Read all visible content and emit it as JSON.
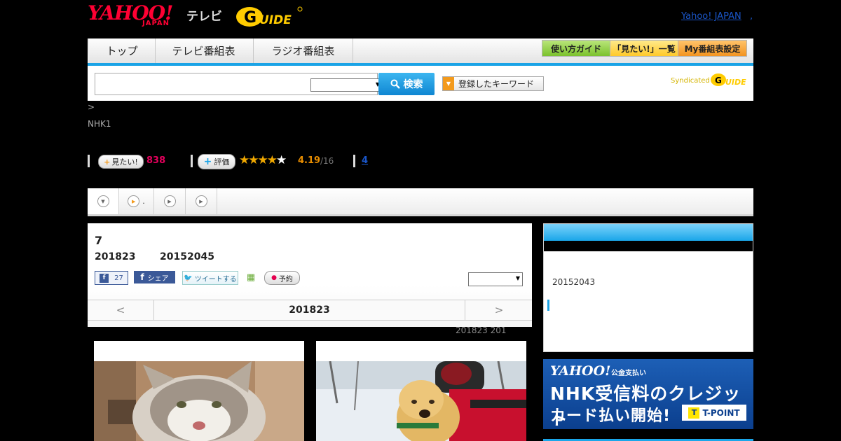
{
  "header": {
    "yahoo_logo": "YAHOO!",
    "yahoo_sub": "JAPAN",
    "tv_label": "テレビ",
    "gguide_label": "G GUIDE",
    "top_link": "Yahoo! JAPAN",
    "top_dot": ","
  },
  "nav": {
    "tabs": [
      "トップ",
      "テレビ番組表",
      "ラジオ番組表"
    ],
    "buttons": [
      {
        "label": "使い方ガイド",
        "color": "#8ccf3c"
      },
      {
        "label": "「見たい!」一覧",
        "color": "#ffd23c"
      },
      {
        "label": "My番組表設定",
        "color": "#f7a330"
      }
    ]
  },
  "search": {
    "placeholder": "",
    "button_label": "検索",
    "keyword_button": "登録したキーワード",
    "syndicated_label": "Syndicated"
  },
  "program_info": {
    "breadcrumb": ">",
    "channel": "NHK1",
    "mitai_label": "見たい!",
    "mitai_count": "838",
    "rate_label": "評価",
    "stars_filled": 4,
    "stars_total": 5,
    "rating_value": "4.19",
    "rating_count": "/16",
    "review_link": "4"
  },
  "tabs_row": [
    {
      "icon": "chevron-down-icon",
      "label": ""
    },
    {
      "icon": "play-icon",
      "label": "."
    },
    {
      "icon": "play-icon",
      "label": ""
    },
    {
      "icon": "play-icon",
      "label": ""
    }
  ],
  "program": {
    "title": "7",
    "date": "201823",
    "time": "20152045",
    "share_count": "27",
    "share_label": "シェア",
    "tweet_label": "ツイートする",
    "reserve_label": "予約",
    "pager_prev": "<",
    "pager_current": "201823",
    "pager_next": ">",
    "range_note": "201823  201"
  },
  "sidebar": {
    "time_text": "20152043"
  },
  "ad": {
    "yahoo": "YAHOO!",
    "sub": "公金支払い",
    "line1": "NHK受信料のクレジット",
    "line2": "カード払い開始!",
    "tpoint": "T-POINT",
    "t_mark": "T"
  },
  "colors": {
    "accent": "#1aa3e6",
    "yahoo_red": "#ff0033",
    "mitai_pink": "#e4005c",
    "rating_orange": "#e88d00",
    "gguide_yellow": "#ffcc00"
  }
}
